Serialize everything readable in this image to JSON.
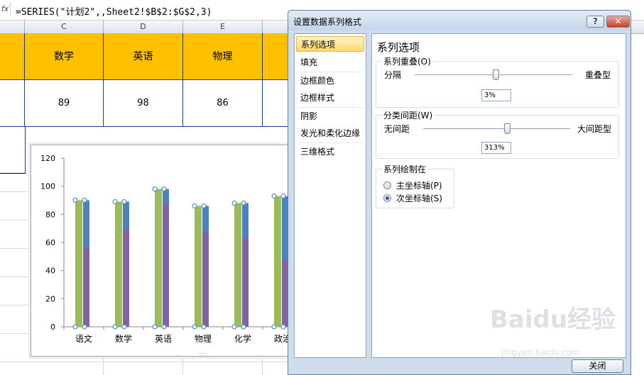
{
  "formula_bar": {
    "fx_label": "fx",
    "formula": "=SERIES(\"计划2\",,Sheet2!$B$2:$G$2,3)"
  },
  "columns": [
    "C",
    "D",
    "E"
  ],
  "header_row": [
    "数学",
    "英语",
    "物理"
  ],
  "value_row": [
    "89",
    "98",
    "86"
  ],
  "chart": {
    "chart_data": {
      "type": "bar",
      "categories": [
        "语文",
        "数学",
        "英语",
        "物理",
        "化学",
        "政治"
      ],
      "series": [
        {
          "color": "#9bbb59",
          "values": [
            90,
            89,
            98,
            86,
            88,
            93
          ]
        },
        {
          "color": "#4f81bd",
          "values": [
            90,
            89,
            98,
            86,
            88,
            93
          ]
        },
        {
          "color": "#8064a2",
          "values": [
            56,
            69,
            87,
            68,
            63,
            48
          ]
        }
      ],
      "ylim": [
        0,
        120
      ],
      "yticks": [
        "0",
        "20",
        "40",
        "60",
        "80",
        "100",
        "120"
      ],
      "grid": false,
      "selected_series": 1
    }
  },
  "dialog": {
    "title": "设置数据系列格式",
    "help_label": "?",
    "close_label": "✕",
    "nav": [
      "系列选项",
      "填充",
      "边框颜色",
      "边框样式",
      "阴影",
      "发光和柔化边缘",
      "三维格式"
    ],
    "selected_nav": 0,
    "panel_title": "系列选项",
    "overlap": {
      "group_label": "系列重叠(O)",
      "min_label": "分隔",
      "max_label": "重叠型",
      "value": "3%",
      "position": 0.515
    },
    "gap": {
      "group_label": "分类间距(W)",
      "min_label": "无间距",
      "max_label": "大间距型",
      "value": "313%",
      "position": 0.57
    },
    "plot_on": {
      "group_label": "系列绘制在",
      "primary_label": "主坐标轴(P)",
      "secondary_label": "次坐标轴(S)",
      "selected": "secondary"
    },
    "close_button": "关闭"
  },
  "watermark": {
    "text": "Baidu经验",
    "sub": "jingyan.baidu.com"
  }
}
